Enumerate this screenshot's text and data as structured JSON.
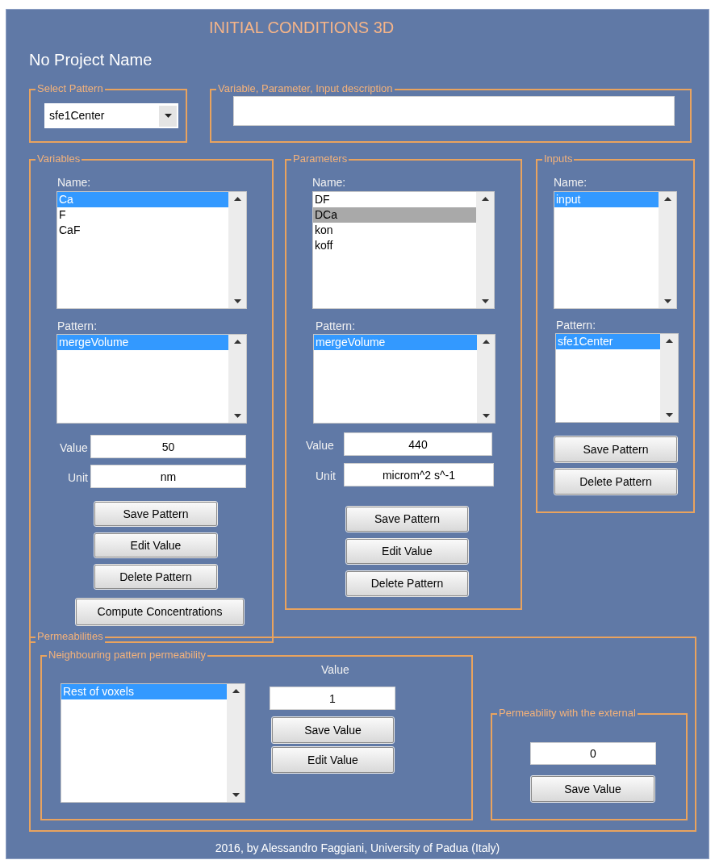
{
  "title": "INITIAL CONDITIONS 3D",
  "project_name": "No Project Name",
  "select_pattern": {
    "label": "Select Pattern",
    "value": "sfe1Center"
  },
  "description": {
    "label": "Variable, Parameter, Input description"
  },
  "variables": {
    "label": "Variables",
    "name_label": "Name:",
    "names": {
      "focused": true,
      "items": [
        {
          "text": "Ca",
          "selected": true
        },
        {
          "text": "F",
          "selected": false
        },
        {
          "text": "CaF",
          "selected": false
        }
      ]
    },
    "pattern_label": "Pattern:",
    "patterns": {
      "focused": true,
      "items": [
        {
          "text": "mergeVolume",
          "selected": true
        }
      ]
    },
    "value_label": "Value",
    "value": "50",
    "unit_label": "Unit",
    "unit": "nm",
    "buttons": [
      "Save Pattern",
      "Edit Value",
      "Delete Pattern",
      "Compute Concentrations"
    ]
  },
  "parameters": {
    "label": "Parameters",
    "name_label": "Name:",
    "names": {
      "focused": false,
      "items": [
        {
          "text": "DF",
          "selected": false
        },
        {
          "text": "DCa",
          "selected": true
        },
        {
          "text": "kon",
          "selected": false
        },
        {
          "text": "koff",
          "selected": false
        }
      ]
    },
    "pattern_label": "Pattern:",
    "patterns": {
      "focused": true,
      "items": [
        {
          "text": "mergeVolume",
          "selected": true
        }
      ]
    },
    "value_label": "Value",
    "value": "440",
    "unit_label": "Unit",
    "unit": "microm^2 s^-1",
    "buttons": [
      "Save Pattern",
      "Edit Value",
      "Delete Pattern"
    ]
  },
  "inputs": {
    "label": "Inputs",
    "name_label": "Name:",
    "names": {
      "focused": true,
      "items": [
        {
          "text": "input",
          "selected": true
        }
      ]
    },
    "pattern_label": "Pattern:",
    "patterns": {
      "focused": true,
      "items": [
        {
          "text": "sfe1Center",
          "selected": true
        }
      ]
    },
    "buttons": [
      "Save Pattern",
      "Delete Pattern"
    ]
  },
  "permeabilities": {
    "label": "Permeabilities",
    "neighbouring": {
      "label": "Neighbouring pattern permeability",
      "value_label": "Value",
      "list": {
        "focused": true,
        "items": [
          {
            "text": "Rest of voxels",
            "selected": true
          }
        ]
      },
      "value": "1",
      "buttons": [
        "Save Value",
        "Edit Value"
      ]
    },
    "external": {
      "label": "Permeability with the external",
      "value": "0",
      "buttons": [
        "Save Value"
      ]
    }
  },
  "footer": "2016, by Alessandro Faggiani, University of Padua (Italy)"
}
